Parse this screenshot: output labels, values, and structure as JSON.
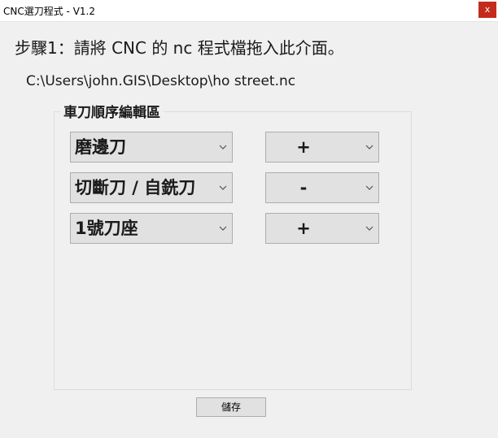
{
  "window": {
    "title": "CNC選刀程式 - V1.2",
    "close_label": "x"
  },
  "step": {
    "text": "步驟1：請將 CNC 的 nc 程式檔拖入此介面。"
  },
  "file": {
    "path": "C:\\Users\\john.GIS\\Desktop\\ho street.nc"
  },
  "editor": {
    "title": "車刀順序編輯區",
    "rows": [
      {
        "tool": "磨邊刀",
        "op": "+"
      },
      {
        "tool": "切斷刀 / 自銑刀",
        "op": "-"
      },
      {
        "tool": "1號刀座",
        "op": "+"
      }
    ]
  },
  "actions": {
    "save_label": "儲存"
  },
  "icons": {
    "dropdown": "chevron-down-icon",
    "close": "close-icon"
  }
}
